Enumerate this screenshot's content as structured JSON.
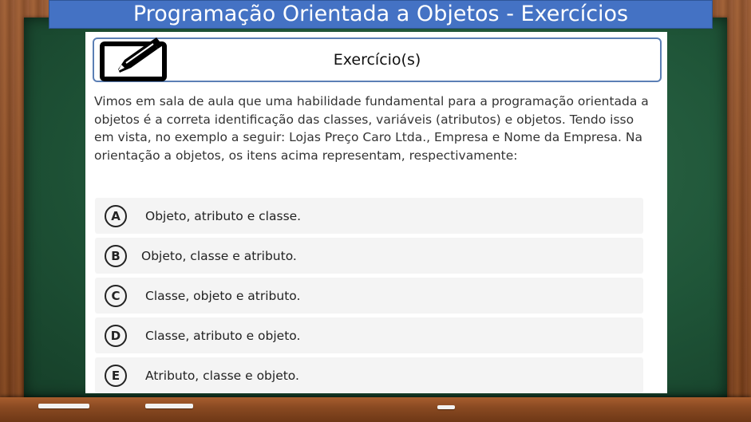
{
  "title": "Programação Orientada a Objetos - Exercícios",
  "header": {
    "label": "Exercício(s)",
    "icon": "pencil-edit-icon"
  },
  "question": "Vimos em sala de aula que uma habilidade fundamental para a programação orientada a objetos é a correta identificação das classes, variáveis (atributos) e objetos. Tendo isso em vista, no exemplo a seguir: Lojas Preço Caro Ltda., Empresa e Nome da Empresa. Na orientação a objetos, os itens acima representam, respectivamente:",
  "options": [
    {
      "letter": "A",
      "text": "Objeto, atributo e classe."
    },
    {
      "letter": "B",
      "text": "Objeto, classe e atributo."
    },
    {
      "letter": "C",
      "text": "Classe, objeto e atributo."
    },
    {
      "letter": "D",
      "text": "Classe, atributo e objeto."
    },
    {
      "letter": "E",
      "text": "Atributo, classe e objeto."
    }
  ],
  "colors": {
    "title_bar": "#4472c4",
    "board": "#1f5538",
    "frame": "#8a4a22"
  }
}
